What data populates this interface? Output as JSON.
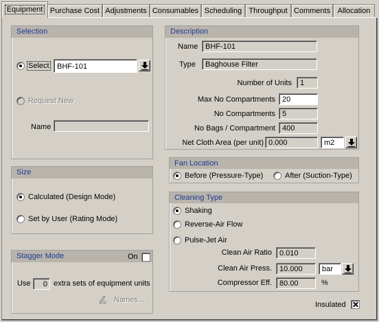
{
  "tabs": [
    "Equipment",
    "Purchase Cost",
    "Adjustments",
    "Consumables",
    "Scheduling",
    "Throughput",
    "Comments",
    "Allocation"
  ],
  "selection": {
    "title": "Selection",
    "select_label": "Select",
    "select_value": "BHF-101",
    "request_new_label": "Request New",
    "name_label": "Name",
    "name_value": ""
  },
  "size": {
    "title": "Size",
    "option1": "Calculated (Design Mode)",
    "option2": "Set by User (Rating Mode)"
  },
  "stagger": {
    "title": "Stagger Mode",
    "on_label": "On",
    "use_label": "Use",
    "extra_value": "0",
    "extra_label": "extra sets of equipment units",
    "names_button": "Names..."
  },
  "description": {
    "title": "Description",
    "name_label": "Name",
    "name_value": "BHF-101",
    "type_label": "Type",
    "type_value": "Baghouse Filter",
    "units_label": "Number of Units",
    "units_value": "1",
    "max_comp_label": "Max No Compartments",
    "max_comp_value": "20",
    "comp_label": "No Compartments",
    "comp_value": "5",
    "bags_label": "No Bags / Compartment",
    "bags_value": "400",
    "cloth_label": "Net Cloth Area (per unit)",
    "cloth_value": "0.000",
    "cloth_unit": "m2"
  },
  "fan": {
    "title": "Fan Location",
    "before": "Before (Pressure-Type)",
    "after": "After (Suction-Type)"
  },
  "cleaning": {
    "title": "Cleaning Type",
    "shaking": "Shaking",
    "reverse": "Reverse-Air Flow",
    "pulse": "Pulse-Jet Air",
    "ratio_label": "Clean Air Ratio",
    "ratio_value": "0.010",
    "press_label": "Clean Air Press.",
    "press_value": "10.000",
    "press_unit": "bar",
    "eff_label": "Compressor Eff.",
    "eff_value": "80.00",
    "eff_unit": "%"
  },
  "insulated_label": "Insulated"
}
